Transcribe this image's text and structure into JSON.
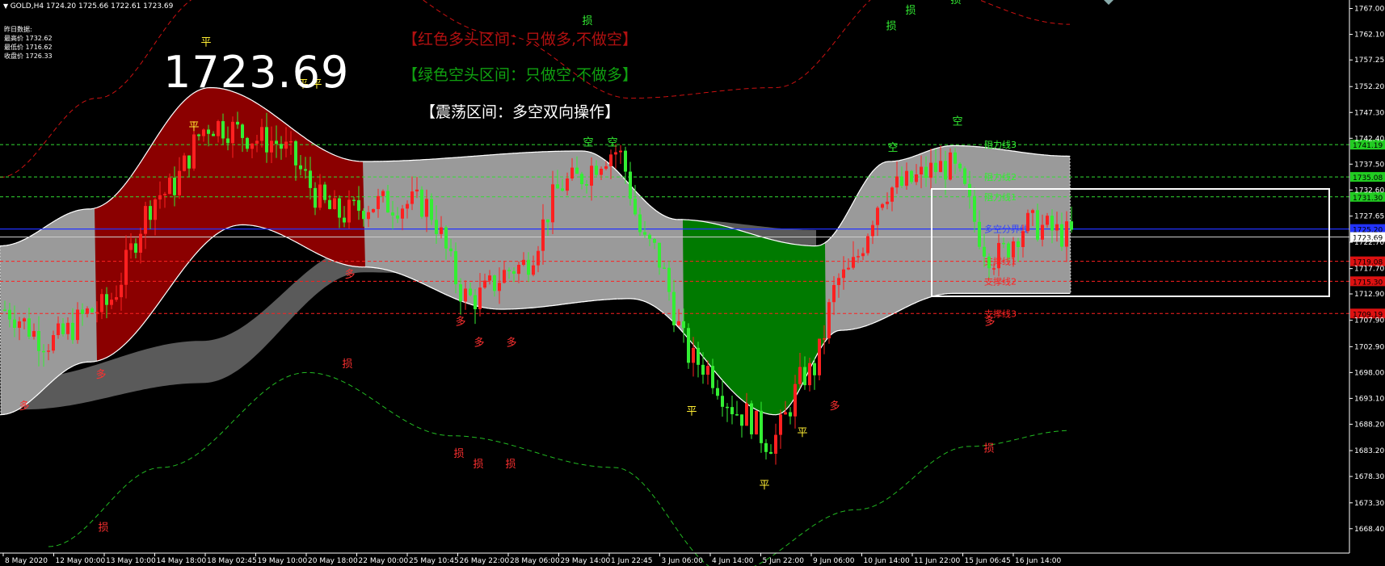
{
  "header": {
    "symbol": "GOLD,H4",
    "ohlc": "1724.20 1725.66 1722.61 1723.69",
    "prev_day_title": "昨日数据:",
    "prev_high": "最高价 1732.62",
    "prev_low": "最低价 1716.62",
    "prev_close": "收盘价 1726.33"
  },
  "big_price": "1723.69",
  "zones": {
    "red": "【红色多头区间：只做多,不做空】",
    "green": "【绿色空头区间：只做空,不做多】",
    "range": "【震荡区间：多空双向操作】"
  },
  "colors": {
    "up_candle": "#ff2020",
    "down_candle": "#33ee33",
    "red_zone": "#8b0000",
    "green_zone": "#007a00",
    "gray_band": "#9a9a9a",
    "dark_band": "#5a5a5a",
    "axis_text": "#ffffff",
    "blue_line": "#2233ff"
  },
  "chart_data": {
    "type": "candlestick",
    "y_ticks": [
      "1767.00",
      "1762.10",
      "1757.25",
      "1752.20",
      "1747.30",
      "1742.40",
      "1737.50",
      "1732.60",
      "1727.65",
      "1722.70",
      "1717.70",
      "1712.90",
      "1707.90",
      "1702.90",
      "1698.00",
      "1693.10",
      "1688.20",
      "1683.20",
      "1678.30",
      "1673.30",
      "1668.40"
    ],
    "ylim": [
      1665,
      1768
    ],
    "x_labels": [
      "8 May 2020",
      "12 May 00:00",
      "13 May 10:00",
      "14 May 18:00",
      "18 May 02:45",
      "19 May 10:00",
      "20 May 18:00",
      "22 May 00:00",
      "25 May 10:45",
      "26 May 22:00",
      "28 May 06:00",
      "29 May 14:00",
      "1 Jun 22:45",
      "3 Jun 06:00",
      "4 Jun 14:00",
      "5 Jun 22:00",
      "9 Jun 06:00",
      "10 Jun 14:00",
      "11 Jun 22:00",
      "15 Jun 06:45",
      "16 Jun 14:00"
    ],
    "levels": [
      {
        "value": 1741.19,
        "label": "1741.19",
        "color": "#33dd33",
        "text": "阻力线3"
      },
      {
        "value": 1735.08,
        "label": "1735.08",
        "color": "#33dd33",
        "text": "阻力线2"
      },
      {
        "value": 1731.3,
        "label": "1731.30",
        "color": "#33dd33",
        "text": "阻力线1"
      },
      {
        "value": 1725.2,
        "label": "1725.20",
        "color": "#2233ff",
        "text": "多空分界线"
      },
      {
        "value": 1723.69,
        "label": "1723.69",
        "color": "#cccccc",
        "text": ""
      },
      {
        "value": 1719.08,
        "label": "1719.08",
        "color": "#ff2020",
        "text": "支撑线1"
      },
      {
        "value": 1715.3,
        "label": "1715.30",
        "color": "#ff2020",
        "text": "支撑线2"
      },
      {
        "value": 1709.19,
        "label": "1709.19",
        "color": "#ff2020",
        "text": "支撑线3"
      }
    ],
    "signal_labels": {
      "long": "多",
      "short": "空",
      "flat": "平",
      "stop": "损"
    }
  }
}
